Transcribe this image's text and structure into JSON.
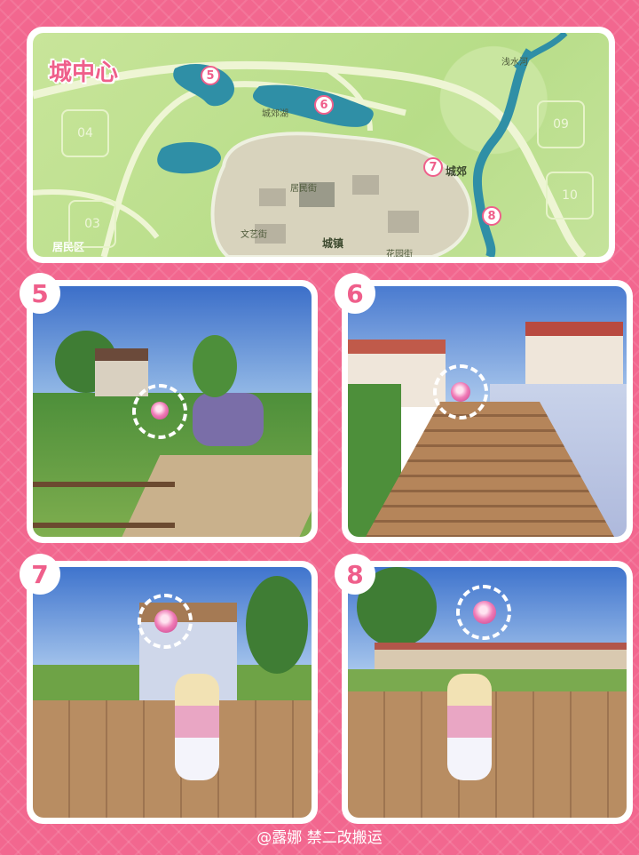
{
  "map": {
    "title": "城中心",
    "labels": {
      "lake": "城郊湖",
      "river": "浅水河",
      "suburb": "城郊",
      "residents_street": "居民街",
      "culture_street": "文艺街",
      "town": "城镇",
      "flower_street": "花园街",
      "residential": "居民区"
    },
    "zones": [
      "04",
      "03",
      "09",
      "10"
    ],
    "pins": [
      "5",
      "6",
      "7",
      "8"
    ]
  },
  "panels": [
    {
      "number": "5"
    },
    {
      "number": "6"
    },
    {
      "number": "7"
    },
    {
      "number": "8"
    }
  ],
  "caption": "@露娜 禁二改搬运",
  "colors": {
    "accent": "#ef5f8b",
    "background": "#f2678f",
    "map_grass": "#c8e59a",
    "water": "#2f8fa6"
  }
}
